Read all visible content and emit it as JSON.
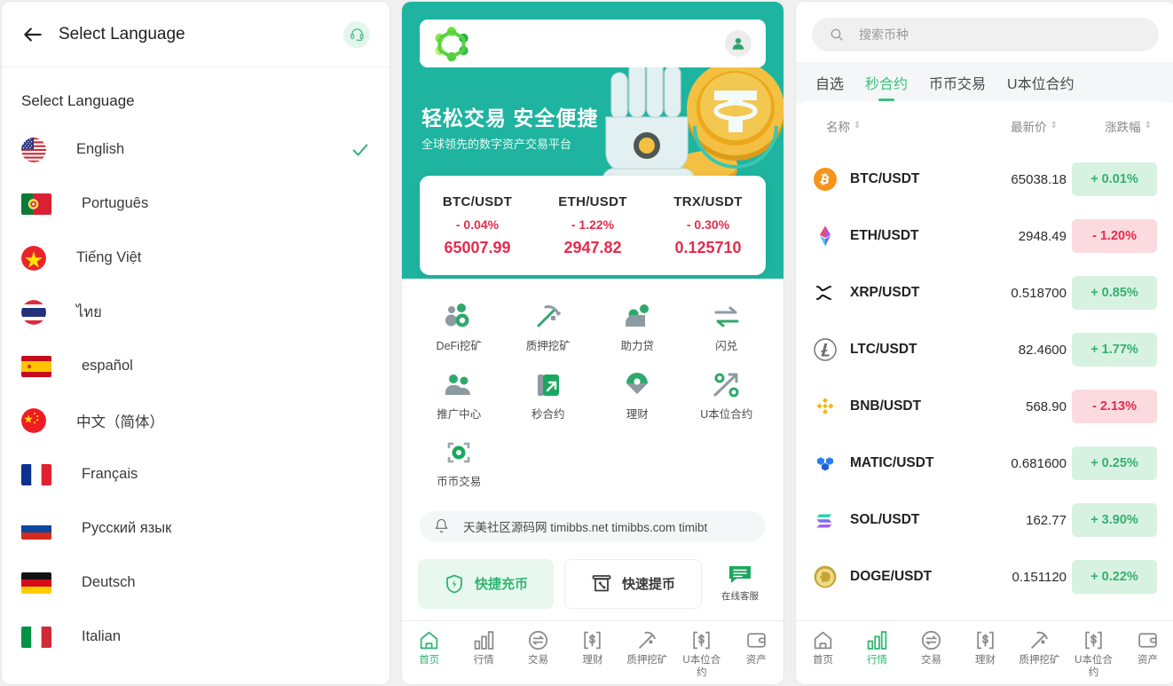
{
  "colors": {
    "teal": "#1eb4a0",
    "green": "#2fb571",
    "green_light": "#e8f8ef",
    "red": "#e42c4d",
    "up_bg": "#d8f2e2",
    "down_bg": "#fbdbe0",
    "gray_bg": "#f5f6f7"
  },
  "left": {
    "header": {
      "title": "Select Language",
      "back_icon": "back-arrow-icon",
      "support_icon": "headset-icon"
    },
    "section_title": "Select Language",
    "languages": [
      {
        "label": "English",
        "flag": "us",
        "selected": true
      },
      {
        "label": "Português",
        "flag": "pt",
        "selected": false
      },
      {
        "label": "Tiếng Việt",
        "flag": "vn",
        "selected": false
      },
      {
        "label": "ไทย",
        "flag": "th",
        "selected": false
      },
      {
        "label": "español",
        "flag": "es",
        "selected": false
      },
      {
        "label": "中文（简体）",
        "flag": "cn",
        "selected": false
      },
      {
        "label": "Français",
        "flag": "fr",
        "selected": false
      },
      {
        "label": "Русский язык",
        "flag": "ru",
        "selected": false
      },
      {
        "label": "Deutsch",
        "flag": "de",
        "selected": false
      },
      {
        "label": "Italian",
        "flag": "it",
        "selected": false
      }
    ]
  },
  "middle": {
    "topbar": {
      "logo": "app-logo-icon",
      "avatar": "user-avatar-icon"
    },
    "hero": {
      "title": "轻松交易 安全便捷",
      "subtitle": "全球领先的数字资产交易平台",
      "art": "robot-hand-usdt-coin"
    },
    "ticker": [
      {
        "pair": "BTC/USDT",
        "change": "- 0.04%",
        "price": "65007.99",
        "dir": "down"
      },
      {
        "pair": "ETH/USDT",
        "change": "- 1.22%",
        "price": "2947.82",
        "dir": "down"
      },
      {
        "pair": "TRX/USDT",
        "change": "- 0.30%",
        "price": "0.125710",
        "dir": "down"
      }
    ],
    "grid": [
      {
        "label": "DeFi挖矿",
        "icon": "defi-mining-icon"
      },
      {
        "label": "质押挖矿",
        "icon": "staking-pickaxe-icon"
      },
      {
        "label": "助力贷",
        "icon": "loan-icon"
      },
      {
        "label": "闪兑",
        "icon": "swap-arrows-icon"
      },
      {
        "label": "推广中心",
        "icon": "referral-people-icon"
      },
      {
        "label": "秒合约",
        "icon": "second-contract-icon"
      },
      {
        "label": "理财",
        "icon": "wealth-umbrella-icon"
      },
      {
        "label": "U本位合约",
        "icon": "usdt-contract-icon"
      },
      {
        "label": "币币交易",
        "icon": "spot-trade-icon"
      }
    ],
    "notice": {
      "icon": "bell-icon",
      "text": "天美社区源码网 timibbs.net timibbs.com timibt"
    },
    "actions": {
      "deposit": {
        "label": "快捷充币",
        "icon": "shield-bolt-icon"
      },
      "withdraw": {
        "label": "快速提币",
        "icon": "atm-percent-icon"
      },
      "support": {
        "label": "在线客服",
        "icon": "chat-icon"
      }
    },
    "tabbar": {
      "active": "首页",
      "items": [
        {
          "label": "首页",
          "icon": "home-icon"
        },
        {
          "label": "行情",
          "icon": "markets-bars-icon"
        },
        {
          "label": "交易",
          "icon": "trade-swap-icon"
        },
        {
          "label": "理财",
          "icon": "finance-dollar-icon"
        },
        {
          "label": "质押挖矿",
          "icon": "pickaxe-icon"
        },
        {
          "label": "U本位合约",
          "icon": "usdt-contract-dollar-icon"
        },
        {
          "label": "资产",
          "icon": "wallet-icon"
        }
      ]
    }
  },
  "right": {
    "search": {
      "placeholder": "搜索币种",
      "icon": "search-icon"
    },
    "tabs": [
      {
        "label": "自选",
        "active": false
      },
      {
        "label": "秒合约",
        "active": true
      },
      {
        "label": "币币交易",
        "active": false
      },
      {
        "label": "U本位合约",
        "active": false
      }
    ],
    "columns": [
      {
        "label": "名称",
        "sortable": true
      },
      {
        "label": "最新价",
        "sortable": true
      },
      {
        "label": "涨跌幅",
        "sortable": true
      }
    ],
    "rows": [
      {
        "name": "BTC/USDT",
        "price": "65038.18",
        "change": "+ 0.01%",
        "dir": "up",
        "icon": "btc-icon"
      },
      {
        "name": "ETH/USDT",
        "price": "2948.49",
        "change": "- 1.20%",
        "dir": "down",
        "icon": "eth-icon"
      },
      {
        "name": "XRP/USDT",
        "price": "0.518700",
        "change": "+ 0.85%",
        "dir": "up",
        "icon": "xrp-icon"
      },
      {
        "name": "LTC/USDT",
        "price": "82.4600",
        "change": "+ 1.77%",
        "dir": "up",
        "icon": "ltc-icon"
      },
      {
        "name": "BNB/USDT",
        "price": "568.90",
        "change": "- 2.13%",
        "dir": "down",
        "icon": "bnb-icon"
      },
      {
        "name": "MATIC/USDT",
        "price": "0.681600",
        "change": "+ 0.25%",
        "dir": "up",
        "icon": "matic-icon"
      },
      {
        "name": "SOL/USDT",
        "price": "162.77",
        "change": "+ 3.90%",
        "dir": "up",
        "icon": "sol-icon"
      },
      {
        "name": "DOGE/USDT",
        "price": "0.151120",
        "change": "+ 0.22%",
        "dir": "up",
        "icon": "doge-icon"
      }
    ],
    "tabbar": {
      "active": "行情",
      "items": [
        {
          "label": "首页",
          "icon": "home-icon"
        },
        {
          "label": "行情",
          "icon": "markets-bars-icon"
        },
        {
          "label": "交易",
          "icon": "trade-swap-icon"
        },
        {
          "label": "理财",
          "icon": "finance-dollar-icon"
        },
        {
          "label": "质押挖矿",
          "icon": "pickaxe-icon"
        },
        {
          "label": "U本位合约",
          "icon": "usdt-contract-dollar-icon"
        },
        {
          "label": "资产",
          "icon": "wallet-icon"
        }
      ]
    }
  }
}
